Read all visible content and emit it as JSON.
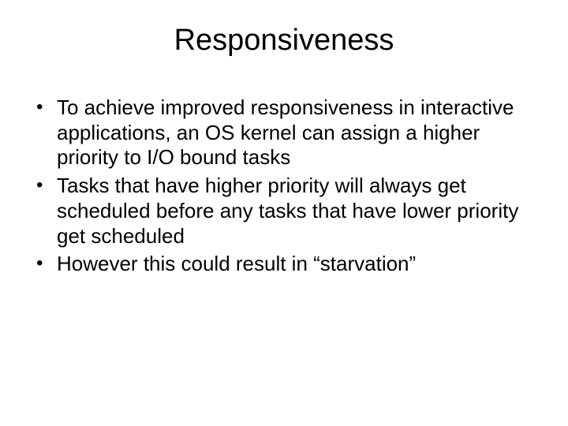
{
  "slide": {
    "title": "Responsiveness",
    "bullets": [
      "To achieve improved responsiveness in interactive applications, an OS kernel can assign a higher priority to I/O bound tasks",
      "Tasks that have higher priority will always get scheduled before any tasks that have lower priority get scheduled",
      "However this could result in “starvation”"
    ]
  }
}
